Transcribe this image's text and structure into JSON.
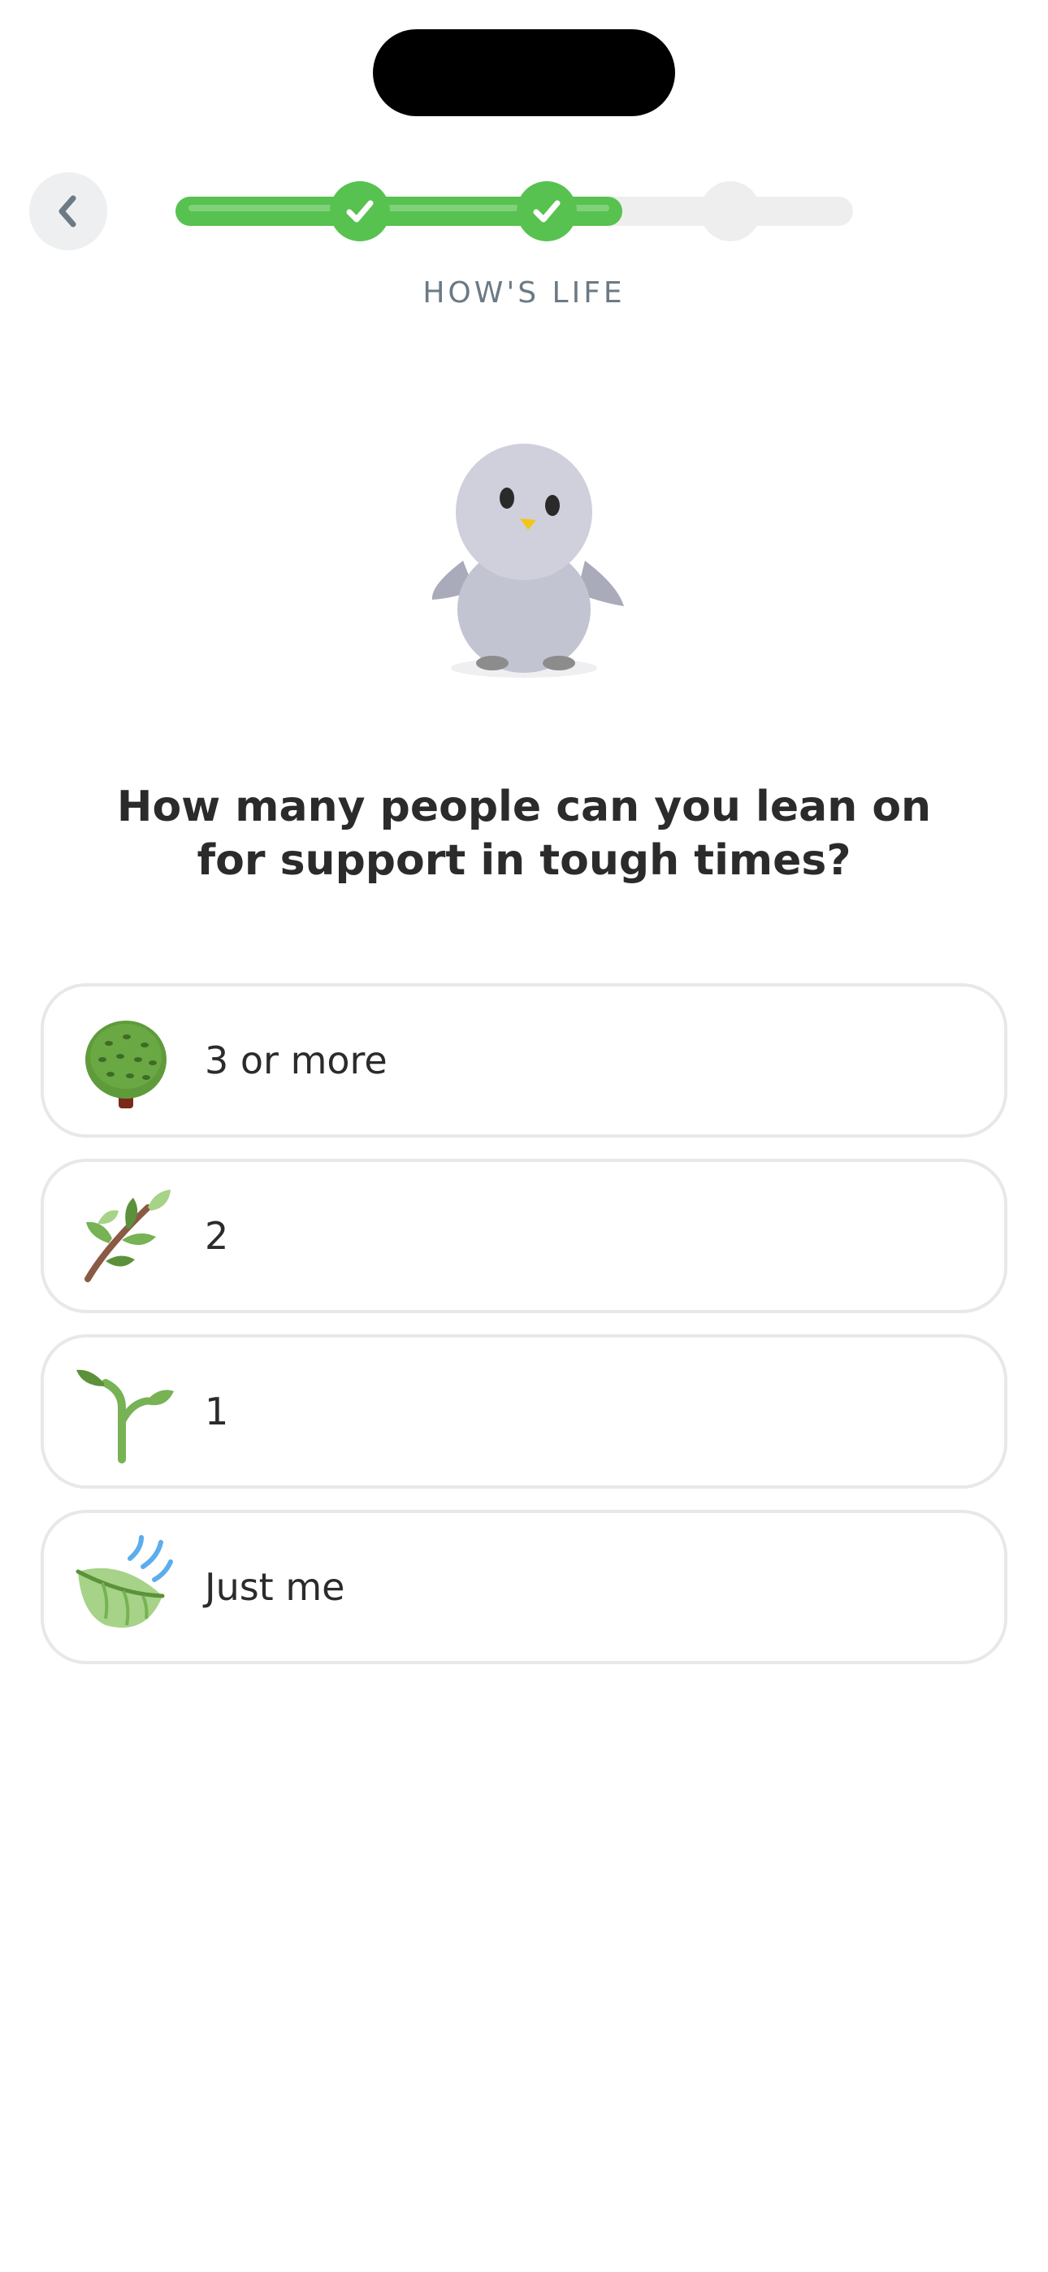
{
  "header": {
    "section_label": "HOW'S LIFE",
    "progress": {
      "completed_steps": 2,
      "total_steps": 3,
      "fill_fraction": 0.66
    }
  },
  "question": "How many people can you lean on for support in tough times?",
  "options": [
    {
      "label": "3 or more",
      "icon": "tree-icon"
    },
    {
      "label": "2",
      "icon": "branch-icon"
    },
    {
      "label": "1",
      "icon": "seedling-icon"
    },
    {
      "label": "Just me",
      "icon": "leaf-in-wind-icon"
    }
  ],
  "colors": {
    "progress_green": "#57c24f",
    "text_dark": "#2b2b2b",
    "label_gray": "#6b7a85",
    "option_border": "#e8e8e8"
  }
}
